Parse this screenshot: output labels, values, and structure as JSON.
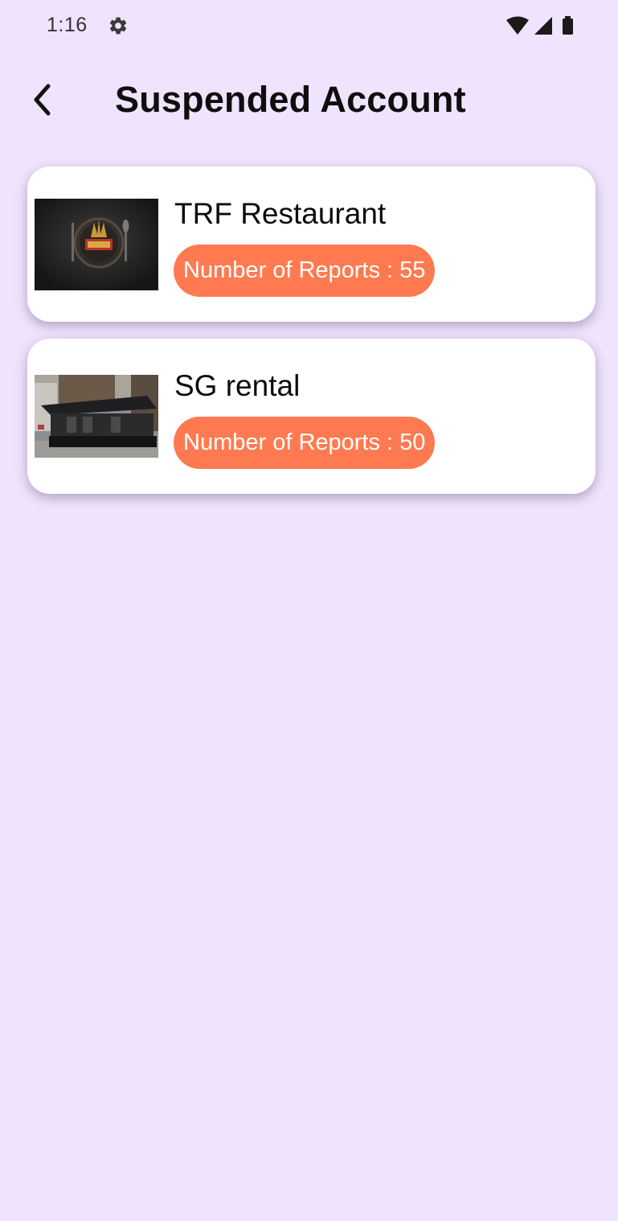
{
  "status_bar": {
    "time": "1:16",
    "icons": [
      "gear-icon",
      "wifi-icon",
      "cell-signal-icon",
      "battery-icon"
    ]
  },
  "header": {
    "title": "Suspended Account",
    "back_icon": "chevron-left-icon"
  },
  "accounts": [
    {
      "name": "TRF Restaurant",
      "reports_label": "Number of Reports : ",
      "reports_count": "55"
    },
    {
      "name": "SG rental",
      "reports_label": "Number of Reports : ",
      "reports_count": "50"
    }
  ],
  "colors": {
    "background": "#efe3fd",
    "card": "#ffffff",
    "badge": "#ff7a50",
    "badge_text": "#ffffff",
    "title": "#0e0e0e"
  }
}
